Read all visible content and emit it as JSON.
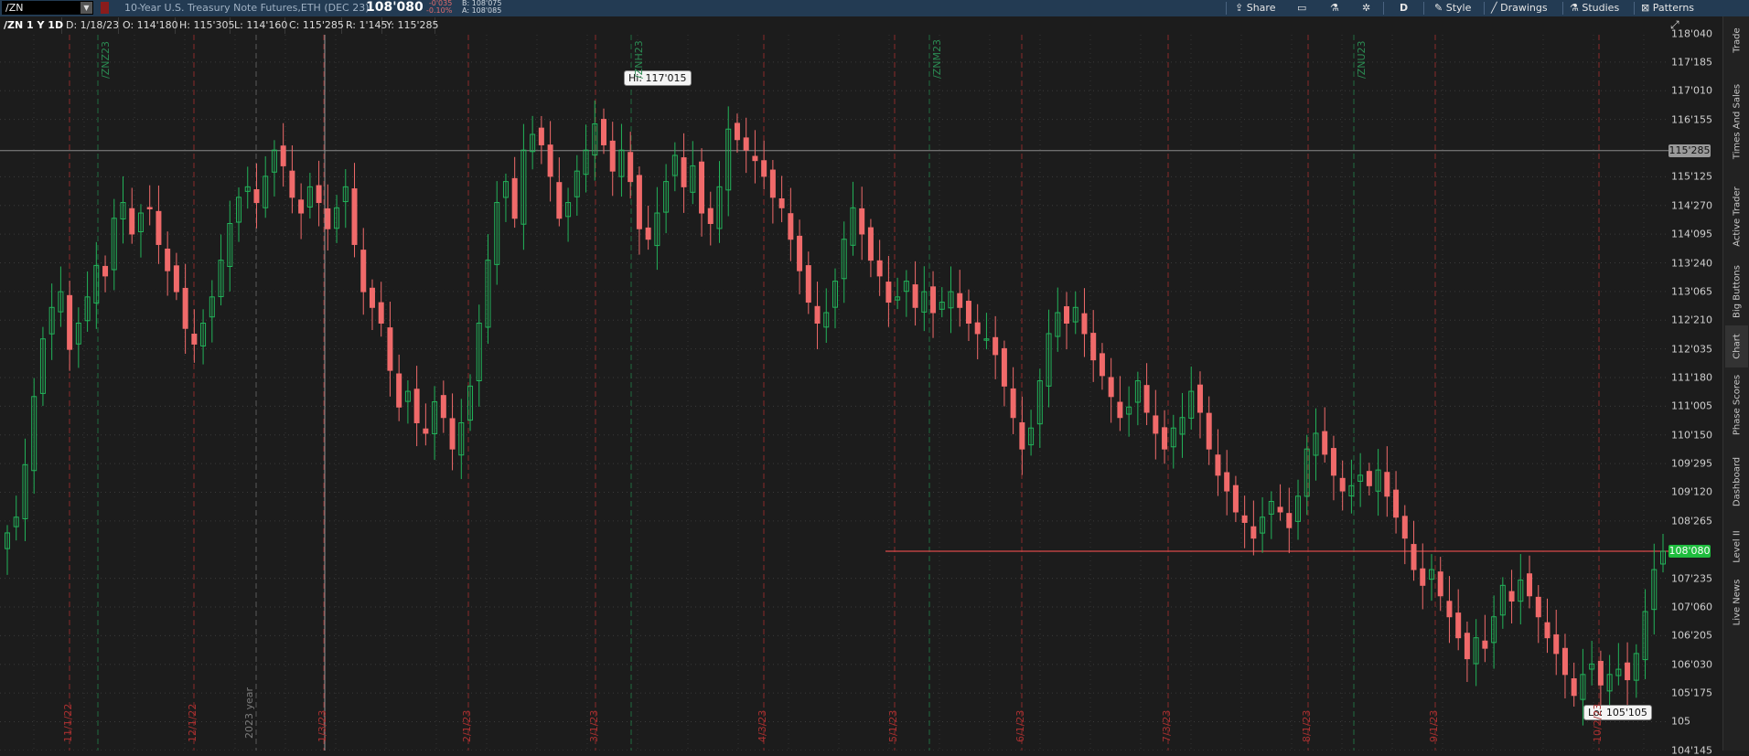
{
  "topbar": {
    "symbol": "/ZN",
    "description": "10-Year U.S. Treasury Note Futures,ETH (DEC 23)",
    "last_price": "108'080",
    "net_change": "-0'035",
    "percent_change": "-0.10%",
    "bid": "B: 108'075",
    "ask": "A: 108'085",
    "share_label": "Share",
    "aggregation_label": "D",
    "style_label": "Style",
    "drawings_label": "Drawings",
    "studies_label": "Studies",
    "patterns_label": "Patterns"
  },
  "infobar": {
    "title": "/ZN 1 Y 1D",
    "date": "D: 1/18/23",
    "open": "O: 114'180",
    "high": "H: 115'305",
    "low": "L: 114'160",
    "close": "C: 115'285",
    "range": "R: 1'145",
    "y": "Y: 115'285"
  },
  "sidebar": {
    "tabs": [
      "Trade",
      "Times And Sales",
      "Active Trader",
      "Big Buttons",
      "Chart",
      "Phase Scores",
      "Dashboard",
      "Level II",
      "Live News"
    ],
    "active": "Chart"
  },
  "colors": {
    "up": "#22b35a",
    "down": "#f06a6a",
    "background": "#1c1c1c",
    "current_price_tag": "#1fbd3e",
    "crosshair_tag": "#9a9a9a"
  },
  "chart_data": {
    "type": "candlestick",
    "instrument": "/ZN",
    "y_axis_ticks": [
      "118'040",
      "117'185",
      "117'010",
      "116'155",
      "115'125",
      "114'270",
      "114'095",
      "113'240",
      "113'065",
      "112'210",
      "112'035",
      "111'180",
      "111'005",
      "110'150",
      "109'295",
      "109'120",
      "108'265",
      "107'235",
      "107'060",
      "106'205",
      "106'030",
      "105'175",
      "105",
      "104'145"
    ],
    "y_range": [
      104.45,
      118.1
    ],
    "current_price": "108'080",
    "crosshair_price": "115'285",
    "high_annotation": "Hi: 117'015",
    "low_annotation": "Lo: 105'105",
    "month_labels": [
      "11/1/22",
      "12/1/22",
      "1/3/23",
      "2/1/23",
      "3/1/23",
      "4/3/23",
      "5/1/23",
      "6/1/23",
      "7/3/23",
      "8/1/23",
      "9/1/23",
      "10/2/23"
    ],
    "year_label": "2023 year",
    "contract_labels": [
      "/ZNZ23",
      "/ZNH23",
      "/ZNM23",
      "/ZNU23"
    ],
    "close_path": [
      108.6,
      108.9,
      109.9,
      111.2,
      112.3,
      112.9,
      113.2,
      112.1,
      112.6,
      113.1,
      113.7,
      113.5,
      114.6,
      114.9,
      114.3,
      114.7,
      114.8,
      114.1,
      113.6,
      113.2,
      112.5,
      112.2,
      112.6,
      113.1,
      113.8,
      114.5,
      115.0,
      115.2,
      114.9,
      115.4,
      115.9,
      115.6,
      115.0,
      114.7,
      115.2,
      114.9,
      114.4,
      114.8,
      115.2,
      114.1,
      113.2,
      112.9,
      112.6,
      111.7,
      111.0,
      111.3,
      110.7,
      110.5,
      111.1,
      110.8,
      110.2,
      110.7,
      111.4,
      112.6,
      113.8,
      114.9,
      115.3,
      114.6,
      115.9,
      116.2,
      116.0,
      115.4,
      114.6,
      114.9,
      115.5,
      115.9,
      116.4,
      116.0,
      115.5,
      115.9,
      115.3,
      114.4,
      114.2,
      114.7,
      115.3,
      115.8,
      115.2,
      115.6,
      114.7,
      114.5,
      115.2,
      116.3,
      116.1,
      115.9,
      115.7,
      115.4,
      115.0,
      114.8,
      114.2,
      113.6,
      113.0,
      112.6,
      112.8,
      113.4,
      114.2,
      114.8,
      114.3,
      113.8,
      113.5,
      113.0,
      113.1,
      113.4,
      112.9,
      113.2,
      112.8,
      113.0,
      113.2,
      112.9,
      112.6,
      112.4,
      112.3,
      112.0,
      111.4,
      110.8,
      110.2,
      110.6,
      111.5,
      112.4,
      112.8,
      112.6,
      112.9,
      112.4,
      111.9,
      111.6,
      111.2,
      110.8,
      111.0,
      111.5,
      110.9,
      110.5,
      110.2,
      110.6,
      110.8,
      111.3,
      110.9,
      110.2,
      109.7,
      109.4,
      109.0,
      108.8,
      108.5,
      108.9,
      109.2,
      109.0,
      108.7,
      109.3,
      110.2,
      110.5,
      110.1,
      109.7,
      109.4,
      109.5,
      109.7,
      109.5,
      109.8,
      109.3,
      108.9,
      108.5,
      107.9,
      107.6,
      107.9,
      107.4,
      107.0,
      106.6,
      106.2,
      106.6,
      106.4,
      107.0,
      107.6,
      107.3,
      107.7,
      107.4,
      107.0,
      106.6,
      106.3,
      105.9,
      105.5,
      105.9,
      106.1,
      105.7,
      105.9,
      106.0,
      105.8,
      106.3,
      107.1,
      107.9,
      108.25
    ]
  }
}
